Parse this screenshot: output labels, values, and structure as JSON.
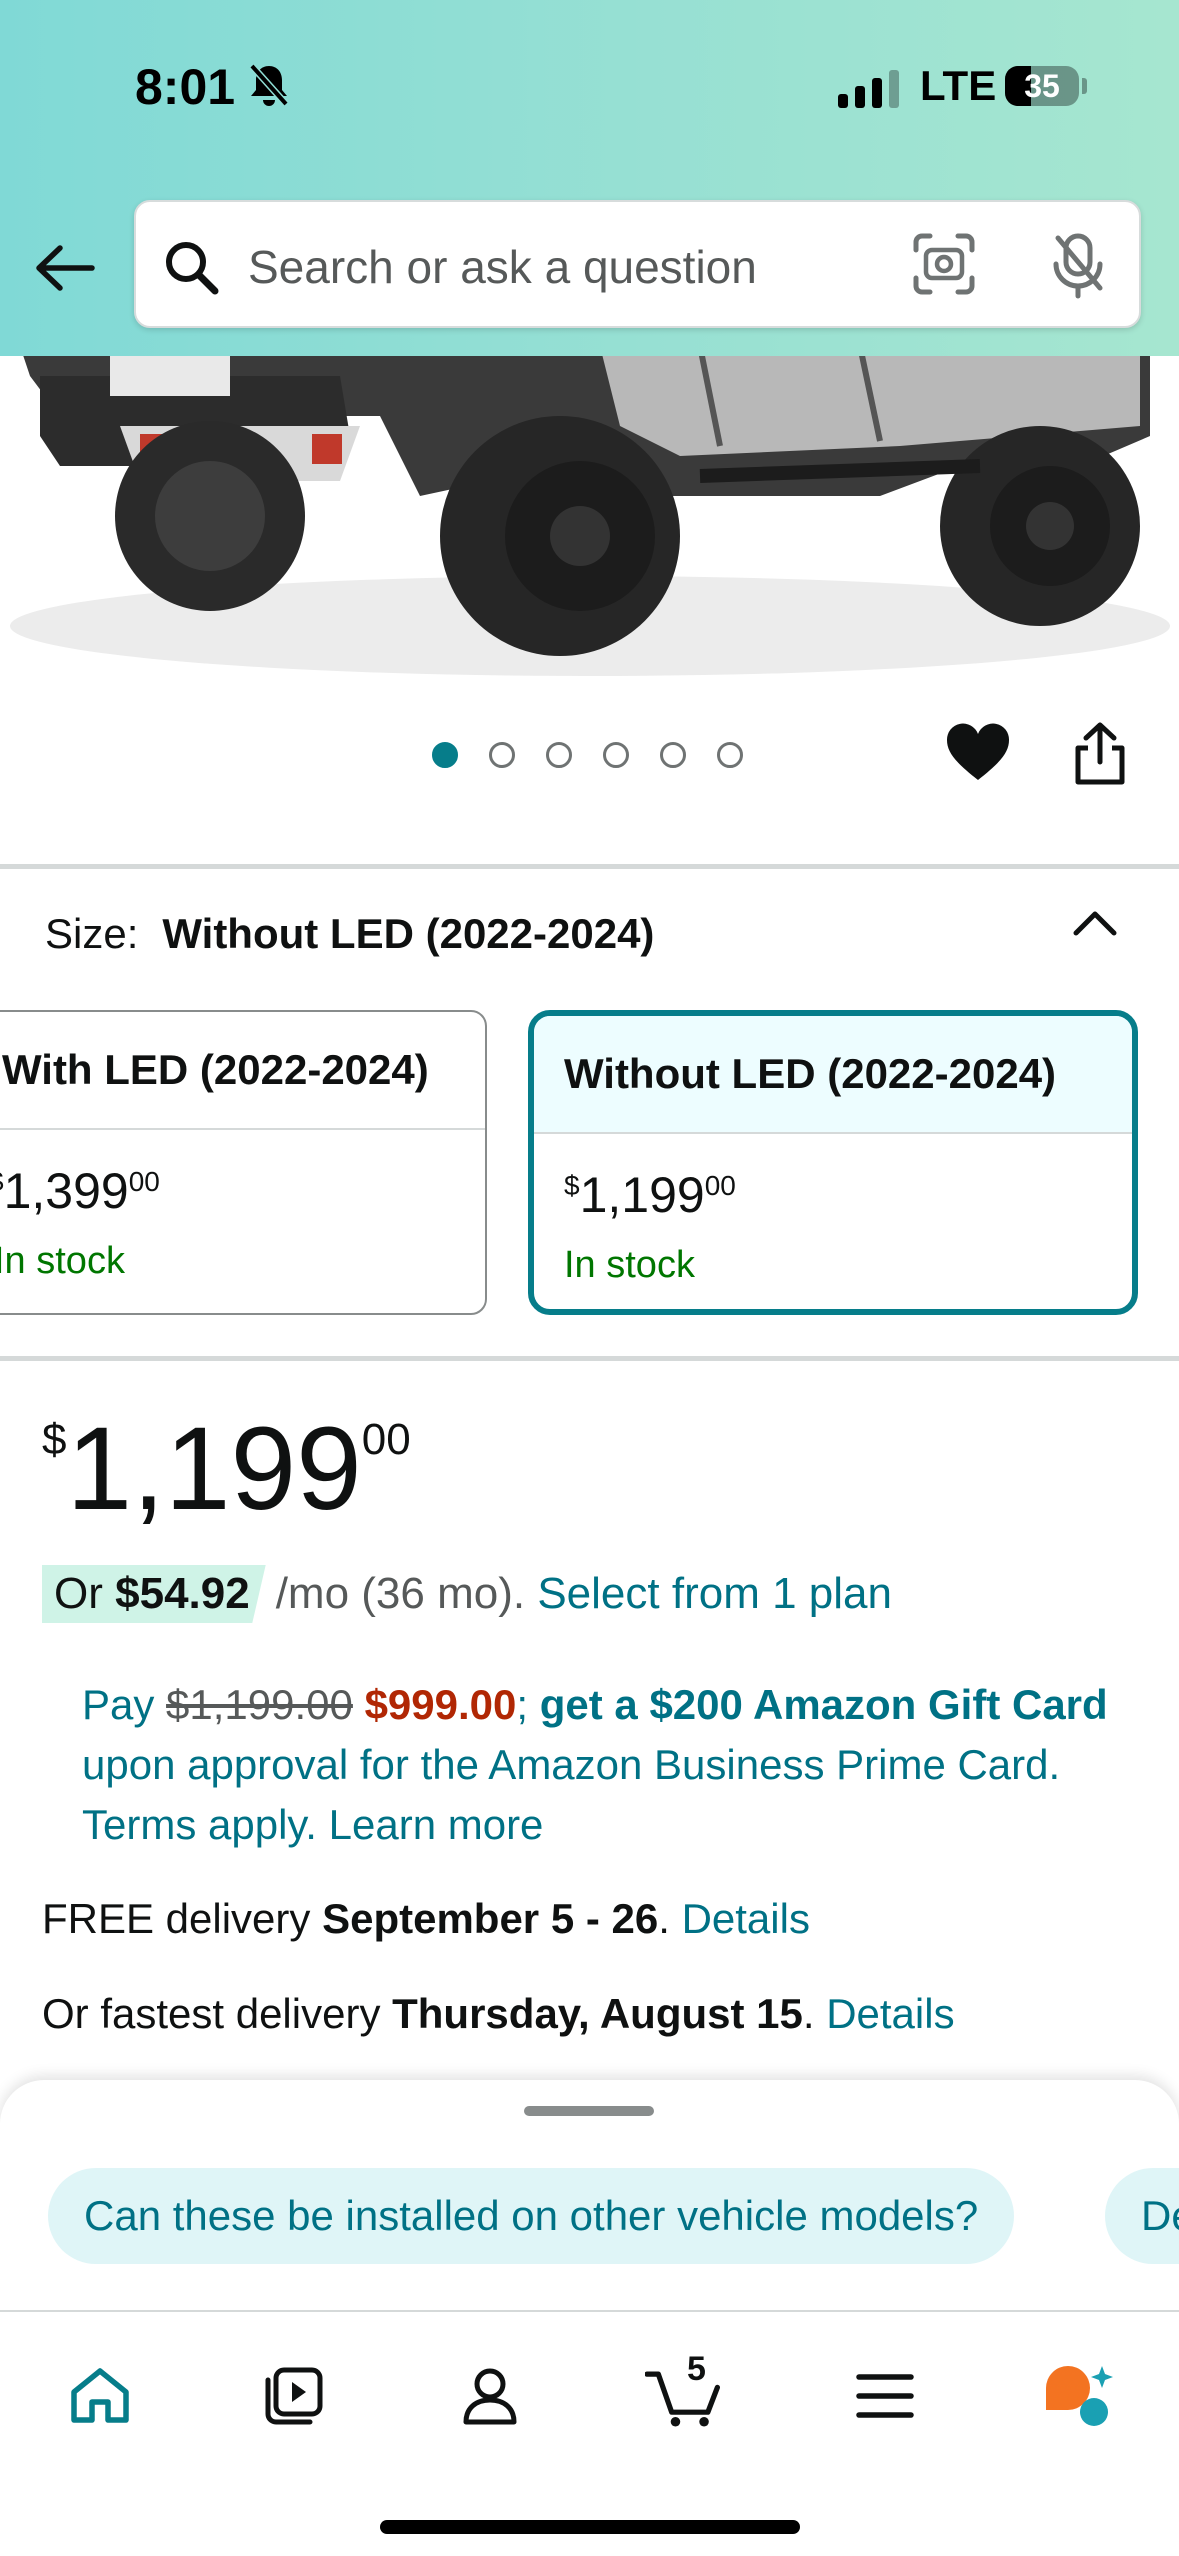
{
  "status_bar": {
    "time": "8:01",
    "network": "LTE",
    "battery": "35",
    "battery_level": 0.35
  },
  "header": {
    "search_placeholder": "Search or ask a question",
    "icons": [
      "back-arrow-icon",
      "search-icon",
      "camera-lens-icon",
      "microphone-icon"
    ]
  },
  "carousel": {
    "total_images": 6,
    "active_index": 0
  },
  "size": {
    "label": "Size:",
    "selected": "Without LED (2022-2024)"
  },
  "variants": [
    {
      "title": "With LED (2022-2024)",
      "price_symbol": "$",
      "price_whole": "1,399",
      "price_cents": "00",
      "stock": "In stock"
    },
    {
      "title": "Without LED (2022-2024)",
      "price_symbol": "$",
      "price_whole": "1,199",
      "price_cents": "00",
      "stock": "In stock"
    }
  ],
  "price": {
    "symbol": "$",
    "whole": "1,199",
    "cents": "00"
  },
  "monthly": {
    "prefix": "Or",
    "amount": "$54.92",
    "term": "/mo (36 mo).",
    "link": "Select from 1 plan"
  },
  "promo": {
    "pay": "Pay",
    "original": "$1,199.00",
    "sale": "$999.00",
    "semicolon": ";",
    "offer": "get a $200 Amazon Gift Card",
    "rest": "upon approval for the Amazon Business Prime Card. Terms apply.",
    "learn_more": "Learn more"
  },
  "delivery": {
    "free_prefix": "FREE delivery",
    "free_dates": "September 5 - 26",
    "fast_prefix": "Or fastest delivery",
    "fast_date": "Thursday, August 15",
    "period": ".",
    "details": "Details"
  },
  "suggestions": [
    "Can these be installed on other vehicle models?",
    "De"
  ],
  "bottom_nav": {
    "cart_count": "5",
    "items": [
      "home-icon",
      "video-icon",
      "account-icon",
      "cart-icon",
      "menu-icon",
      "rufus-icon"
    ]
  },
  "colors": {
    "accent": "#067d8a",
    "link": "#007185",
    "in_stock": "#007600",
    "sale": "#b12704"
  }
}
